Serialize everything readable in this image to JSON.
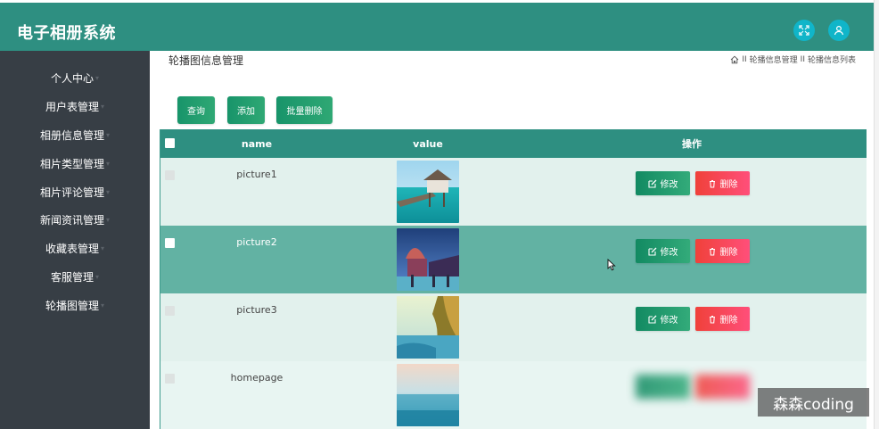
{
  "header": {
    "app_title": "电子相册系统",
    "expand_icon": "expand-icon",
    "user_icon": "user-icon",
    "color": "#2e8f81"
  },
  "sidebar": {
    "items": [
      {
        "label": "个人中心"
      },
      {
        "label": "用户表管理"
      },
      {
        "label": "相册信息管理"
      },
      {
        "label": "相片类型管理"
      },
      {
        "label": "相片评论管理"
      },
      {
        "label": "新闻资讯管理"
      },
      {
        "label": "收藏表管理"
      },
      {
        "label": "客服管理"
      },
      {
        "label": "轮播图管理"
      }
    ],
    "caret": "▾"
  },
  "page": {
    "heading": "轮播图信息管理",
    "breadcrumb": [
      "轮播信息管理",
      "轮播信息列表"
    ],
    "breadcrumb_separator": "II"
  },
  "toolbar": {
    "search_label": "查询",
    "add_label": "添加",
    "batch_delete_label": "批量删除"
  },
  "table": {
    "headers": {
      "name": "name",
      "value": "value",
      "actions": "操作"
    },
    "rows": [
      {
        "name": "picture1",
        "edit": "修改",
        "delete": "删除"
      },
      {
        "name": "picture2",
        "edit": "修改",
        "delete": "删除"
      },
      {
        "name": "picture3",
        "edit": "修改",
        "delete": "删除"
      },
      {
        "name": "homepage",
        "edit": "修改",
        "delete": "删除"
      }
    ],
    "highlighted_row": 1,
    "row_color": "#e2f1ed",
    "highlight_color": "#62b2a3"
  },
  "watermark": "森森coding"
}
